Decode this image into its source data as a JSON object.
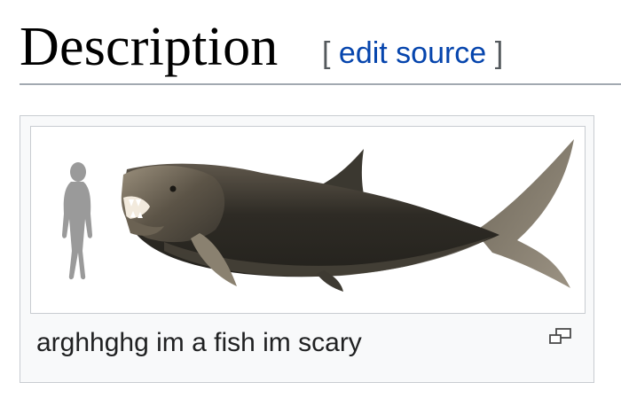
{
  "section": {
    "title": "Description",
    "edit_open_bracket": "[",
    "edit_label": "edit source",
    "edit_close_bracket": "]"
  },
  "figure": {
    "caption": "arghhghg im a fish im scary",
    "enlarge_icon": "magnify-clip-icon",
    "image_subject": "prehistoric-fish-with-human-scale-silhouette"
  },
  "colors": {
    "link": "#0645ad",
    "rule": "#a2a9b1",
    "thumb_border": "#c8ccd1",
    "thumb_bg": "#f8f9fa"
  }
}
